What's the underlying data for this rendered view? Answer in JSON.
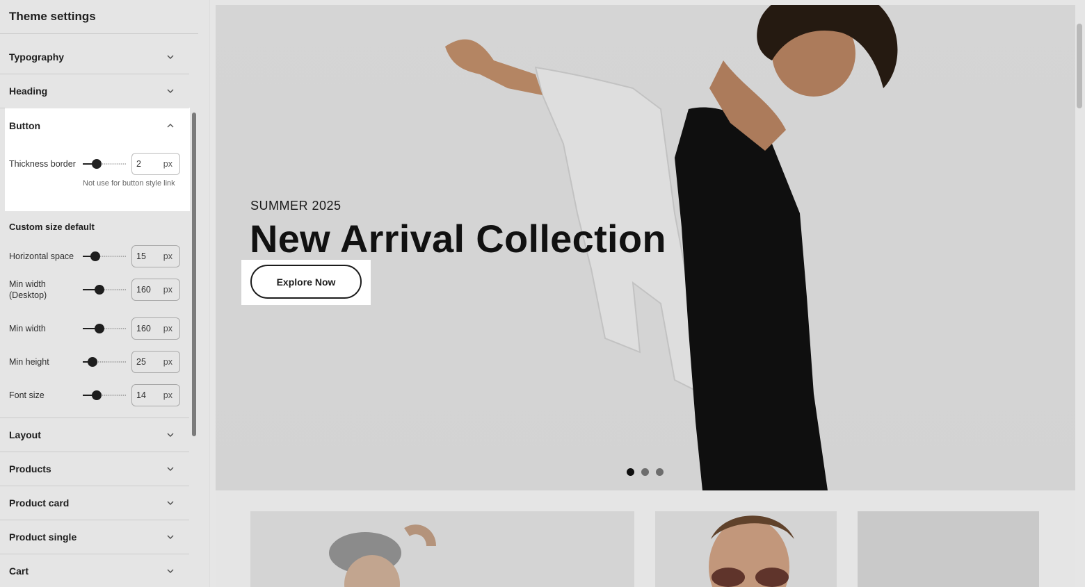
{
  "sidebar": {
    "title": "Theme settings",
    "sections_top": [
      {
        "label": "Typography"
      },
      {
        "label": "Heading"
      },
      {
        "label": "Button"
      }
    ],
    "button_section": {
      "thickness_label": "Thickness border",
      "thickness_value": "2",
      "thickness_fraction": 0.25,
      "unit": "px",
      "hint": "Not use for button style link",
      "custom_heading": "Custom size default",
      "settings": [
        {
          "label": "Horizontal space",
          "value": "15",
          "fraction": 0.21
        },
        {
          "label": "Min width (Desktop)",
          "value": "160",
          "fraction": 0.35
        },
        {
          "label": "Min width",
          "value": "160",
          "fraction": 0.35
        },
        {
          "label": "Min height",
          "value": "25",
          "fraction": 0.12
        },
        {
          "label": "Font size",
          "value": "14",
          "fraction": 0.27
        }
      ]
    },
    "sections_bottom": [
      {
        "label": "Layout"
      },
      {
        "label": "Products"
      },
      {
        "label": "Product card"
      },
      {
        "label": "Product single"
      },
      {
        "label": "Cart"
      }
    ]
  },
  "hero": {
    "subtitle": "SUMMER 2025",
    "title": "New Arrival Collection",
    "button_label": "Explore Now",
    "slides": 3,
    "active_slide": 1
  },
  "icons": {
    "chevron_down": "chevron-down-icon",
    "chevron_up": "chevron-up-icon"
  }
}
